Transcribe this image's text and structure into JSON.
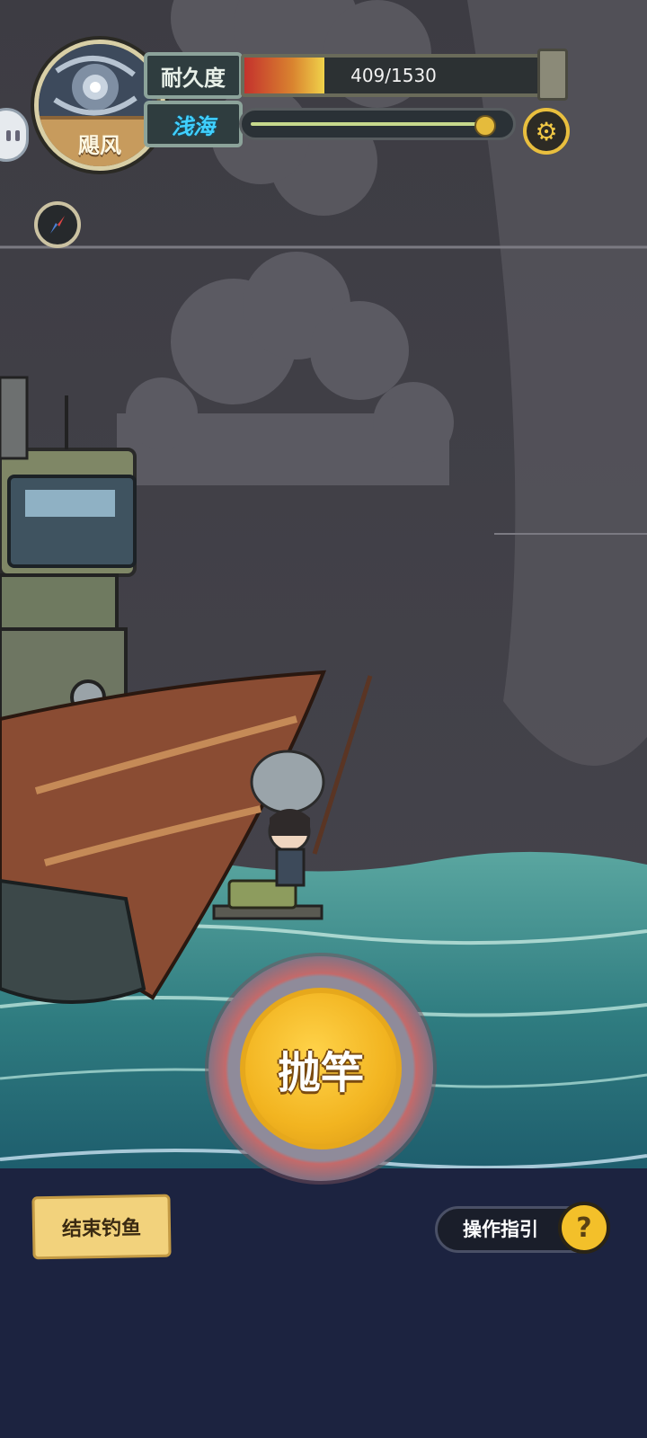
{
  "weather": {
    "name": "飓风",
    "icon": "hurricane-icon"
  },
  "durability": {
    "label": "耐久度",
    "text": "409/1530",
    "current": 409,
    "max": 1530
  },
  "depth": {
    "label": "浅海",
    "progress_percent": 92
  },
  "buttons": {
    "cast": "抛竿",
    "end_fishing": "结束钓鱼",
    "guide": "操作指引",
    "guide_icon": "?"
  },
  "icons": {
    "settings": "gear-icon",
    "compass": "compass-icon",
    "chat": "chat-bubble-icon"
  },
  "colors": {
    "accent_gold": "#F2B420",
    "sea_deep": "#1C2340",
    "depth_text": "#40D0FF"
  }
}
